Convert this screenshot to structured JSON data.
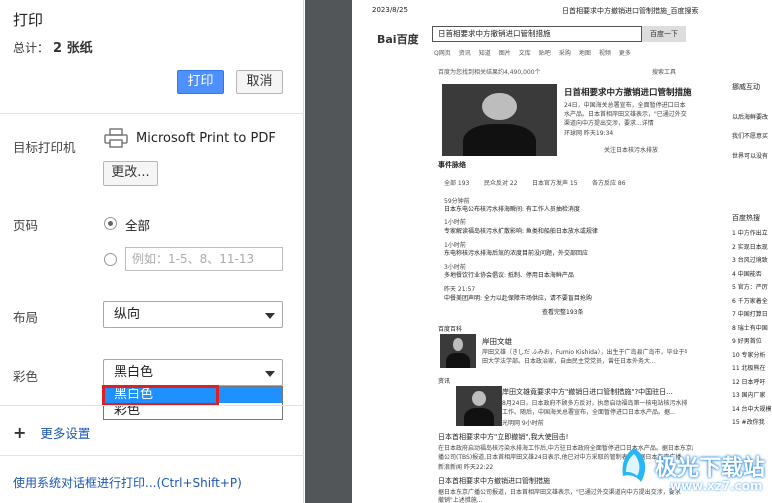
{
  "print_panel": {
    "title": "打印",
    "total_label": "总计：",
    "total_value": "2 张纸",
    "print_button": "打印",
    "cancel_button": "取消",
    "destination_label": "目标打印机",
    "printer_name": "Microsoft Print to PDF",
    "change_button": "更改...",
    "pages_label": "页码",
    "pages_all": "全部",
    "pages_placeholder": "例如：1-5、8、11-13",
    "layout_label": "布局",
    "layout_value": "纵向",
    "color_label": "彩色",
    "color_value": "黑白色",
    "color_options": [
      "黑白色",
      "彩色"
    ],
    "more_settings": "更多设置",
    "system_dialog": "使用系统对话框进行打印...(Ctrl+Shift+P)"
  },
  "preview": {
    "date": "2023/8/25",
    "doc_title": "日首相要求中方撤销进口管制措施_百度搜索",
    "logo": "Bai百度",
    "search_query": "日首相要求中方撤销进口管制措施",
    "search_button": "百度一下",
    "nav": [
      "Q网页",
      "资讯",
      "知道",
      "图片",
      "文库",
      "贴吧",
      "采购",
      "地图",
      "视频",
      "更多"
    ],
    "result_count": "百度为您找到相关结果约4,490,000个",
    "tools": "搜索工具",
    "card_title": "日首相要求中方撤销进口管制措施",
    "card_snippet_1": "24日，中国海关总署宣布，全面暂停进口日本",
    "card_snippet_2": "水产品。日本首相岸田文雄表示，\"已通过外交",
    "card_snippet_3": "渠道向中方提出交涉，要求...详情",
    "card_source": "环球网  昨天19:34",
    "card_follow": "关注日本核污水排放",
    "events_title": "事件脉络",
    "tabs": [
      "全部 193",
      "民众反对 22",
      "日本官方发声 15",
      "各方反应 86"
    ],
    "events": [
      {
        "time": "59分钟前",
        "text": "日本东电公布核污水排海瞬间: 有工作人员抽检消度"
      },
      {
        "time": "1小时前",
        "text": "专家解读福岛核污水扩散影响: 鱼类和船舶日本放水或规律"
      },
      {
        "time": "1小时前",
        "text": "东电称核污水排海后氚的浓度目前没问题，外交部回应"
      },
      {
        "time": "3小时前",
        "text": "多地餐饮行业协会倡议: 抵制、停用日本海鲜产品"
      },
      {
        "time": "昨天 21:57",
        "text": "中餐美团声明: 全力以赴保障市场供应，请不要盲目抢购"
      }
    ],
    "more_events": "查看完整193条",
    "baike_label": "百度百科",
    "baike_title": "岸田文雄",
    "baike_text_1": "岸田文雄（きしだ ふみお，Fumio Kishida），出生于广岛县广岛市，毕业于早稻",
    "baike_text_2": "田大学法学部。日本政治家，自由民主党党员，曾任日本外务大...",
    "news_label": "资讯",
    "news_title": "岸田文雄竟要求中方\"撤销日进口管制措施\"?中国驻日...",
    "news_text_1": "8月24日，日本政府不顾多方反对，执意启动福岛第一核电站核污水排海",
    "news_text_2": "工作。随后，中国海关总署宣布，全面暂停进口日本水产品。据...",
    "news_source": "光明网  9小时前",
    "result2_title": "日本首相要求中方\"立即撤销\",我大使回击!",
    "result2_text_1": "在日本政府启动福岛核污染水排海工作后,中方驻日本政府全面暂停进口日本水产品。据日本东京广",
    "result2_text_2": "播公司(TBS)报道,日本首相岸田文雄24日表示,他已对中方采取的管制表示...据日本东京广播",
    "result2_source": "新浪新闻  昨天22:22",
    "result3_title": "日本首相要求中方撤销进口管制措施",
    "result3_text_1": "据日本东京广播公司报道，日本首相岸田文雄表示，\"已通过外交渠道向中方提出交涉，要求",
    "result3_text_2": "撤销\"上述措施...",
    "side_hot": "挪威互动",
    "side_items": [
      "以后海鲜要改",
      "我们不愿意买",
      "世界可以没有"
    ],
    "side_rank_title": "百度热搜",
    "side_rank": [
      "中方作出立",
      "实现日本现",
      "台风过境致",
      "中国能否",
      "官方：严厉",
      "千万家着全",
      "中国打算日",
      "瑞士有中国",
      "好男首位",
      "专家分析",
      "北极熊在",
      "日本呼吁",
      "国内厂家",
      "台中大规模",
      "#改你我"
    ]
  },
  "watermark": {
    "text": "极光下载站",
    "url": "www.xz7.com"
  }
}
